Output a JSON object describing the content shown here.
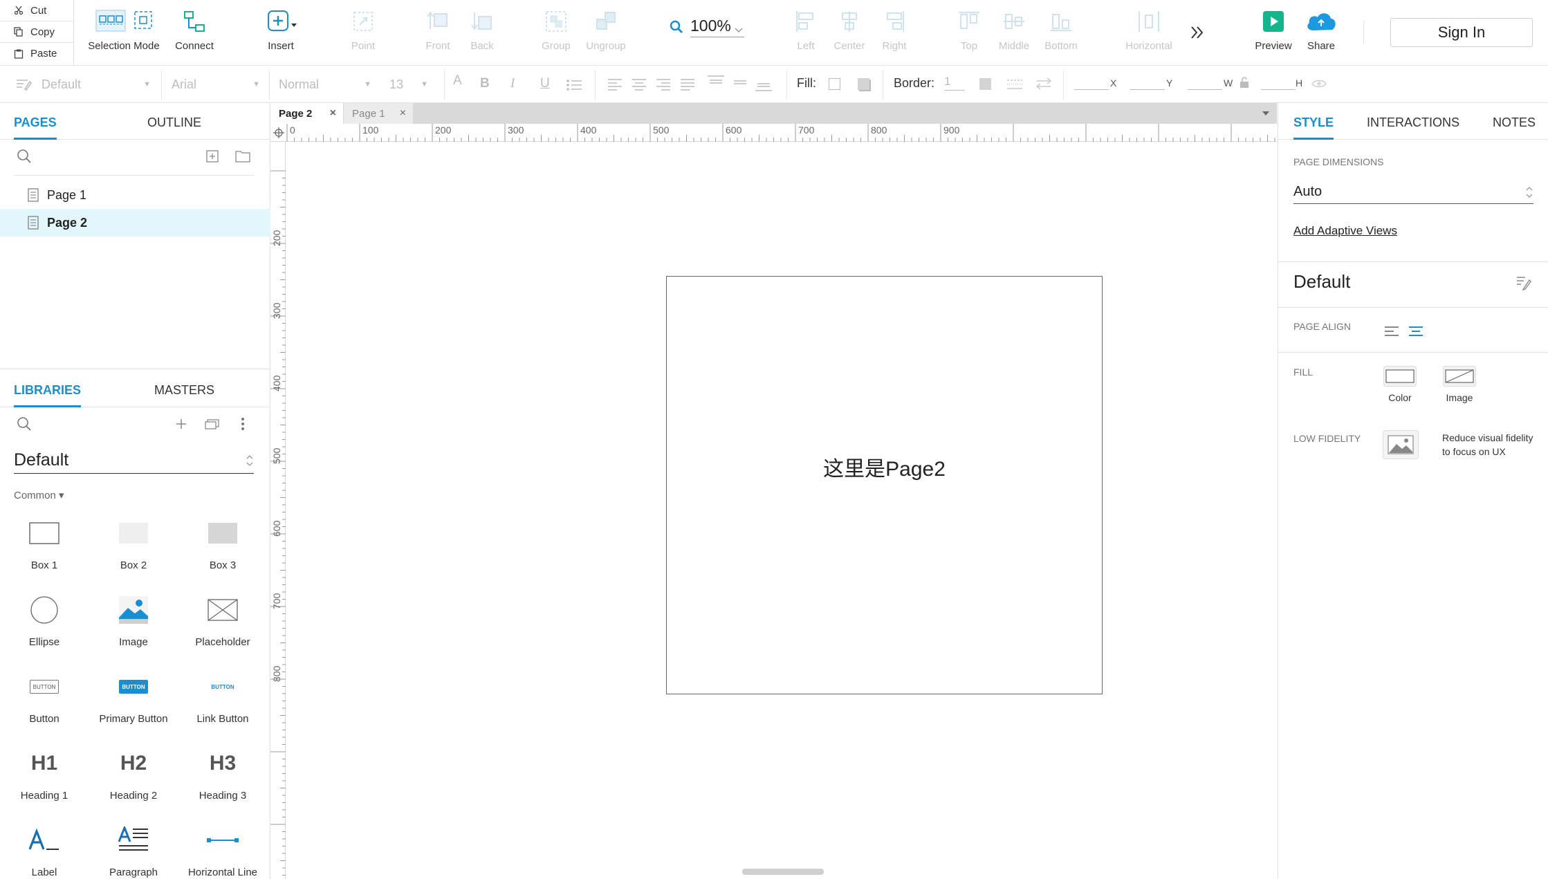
{
  "clipboard": {
    "cut": "Cut",
    "copy": "Copy",
    "paste": "Paste"
  },
  "toolbar": {
    "selection_mode": "Selection Mode",
    "connect": "Connect",
    "insert": "Insert",
    "point": "Point",
    "front": "Front",
    "back": "Back",
    "group": "Group",
    "ungroup": "Ungroup",
    "zoom": "100%",
    "left": "Left",
    "center": "Center",
    "right": "Right",
    "top": "Top",
    "middle": "Middle",
    "bottom": "Bottom",
    "horizontal": "Horizontal",
    "preview": "Preview",
    "share": "Share",
    "sign_in": "Sign In"
  },
  "format": {
    "style": "Default",
    "font": "Arial",
    "weight": "Normal",
    "size": "13",
    "fill_label": "Fill:",
    "border_label": "Border:",
    "border_value": "1",
    "x": "X",
    "y": "Y",
    "w": "W",
    "h": "H"
  },
  "pages_panel": {
    "tab_pages": "PAGES",
    "tab_outline": "OUTLINE",
    "pages": [
      "Page 1",
      "Page 2"
    ],
    "selected": "Page 2"
  },
  "libraries_panel": {
    "tab_libraries": "LIBRARIES",
    "tab_masters": "MASTERS",
    "library": "Default",
    "category": "Common ▾",
    "widgets": [
      "Box 1",
      "Box 2",
      "Box 3",
      "Ellipse",
      "Image",
      "Placeholder",
      "Button",
      "Primary Button",
      "Link Button",
      "Heading 1",
      "Heading 2",
      "Heading 3",
      "Label",
      "Paragraph",
      "Horizontal Line"
    ],
    "button_text": "BUTTON",
    "h1": "H1",
    "h2": "H2",
    "h3": "H3"
  },
  "doc_tabs": [
    {
      "label": "Page 2",
      "active": true
    },
    {
      "label": "Page 1",
      "active": false
    }
  ],
  "ruler": {
    "h_ticks": [
      "0",
      "100",
      "200",
      "300",
      "400",
      "500",
      "600",
      "700",
      "800",
      "900"
    ],
    "v_ticks": [
      "200",
      "300",
      "400",
      "500",
      "600",
      "700",
      "800"
    ]
  },
  "canvas": {
    "text": "这里是Page2"
  },
  "style_panel": {
    "tab_style": "STYLE",
    "tab_interactions": "INTERACTIONS",
    "tab_notes": "NOTES",
    "page_dimensions_label": "PAGE DIMENSIONS",
    "page_dimensions": "Auto",
    "add_adaptive": "Add Adaptive Views",
    "style_name": "Default",
    "page_align_label": "PAGE ALIGN",
    "fill_label": "FILL",
    "fill_color": "Color",
    "fill_image": "Image",
    "low_fidelity_label": "LOW FIDELITY",
    "low_fidelity_desc1": "Reduce visual fidelity",
    "low_fidelity_desc2": "to focus on UX"
  },
  "colors": {
    "accent": "#1a8fd0",
    "preview_green": "#14b58d",
    "share_blue": "#1a9ae0"
  }
}
